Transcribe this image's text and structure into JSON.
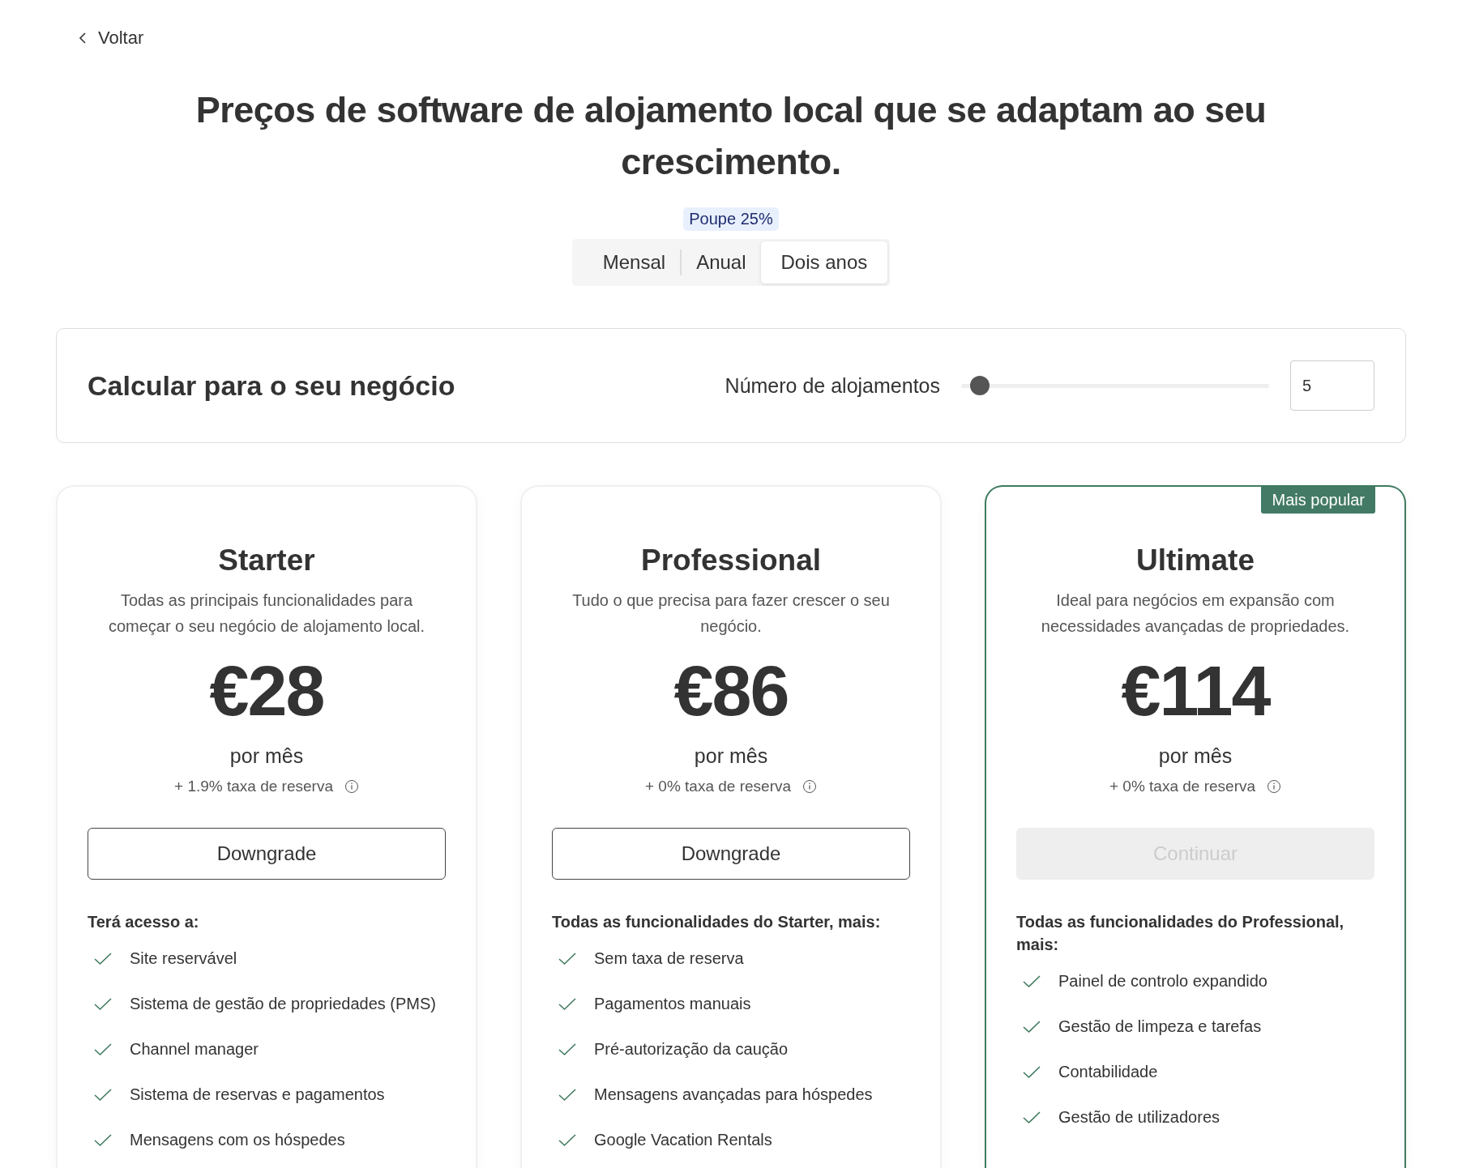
{
  "back_link": {
    "label": "Voltar"
  },
  "title": "Preços de software de alojamento local que se adaptam ao seu crescimento.",
  "savings_badge": "Poupe 25%",
  "billing_tabs": [
    {
      "label": "Mensal",
      "selected": false
    },
    {
      "label": "Anual",
      "selected": false
    },
    {
      "label": "Dois anos",
      "selected": true
    }
  ],
  "calculator": {
    "title": "Calcular para o seu negócio",
    "slider_label": "Número de alojamentos",
    "slider": {
      "level": 0.04
    },
    "value": "5"
  },
  "plans": [
    {
      "name": "Starter",
      "popular": false,
      "description": "Todas as principais funcionalidades para começar o seu negócio de alojamento local.",
      "price": "€28",
      "period": "por mês",
      "fee": "+ 1.9% taxa de reserva",
      "button": {
        "label": "Downgrade",
        "disabled": false
      },
      "features_title": "Terá acesso a:",
      "features": [
        "Site reservável",
        "Sistema de gestão de propriedades (PMS)",
        "Channel manager",
        "Sistema de reservas e pagamentos",
        "Mensagens com os hóspedes"
      ]
    },
    {
      "name": "Professional",
      "popular": false,
      "description": "Tudo o que precisa para fazer crescer o seu negócio.",
      "price": "€86",
      "period": "por mês",
      "fee": "+ 0% taxa de reserva",
      "button": {
        "label": "Downgrade",
        "disabled": false
      },
      "features_title": "Todas as funcionalidades do Starter, mais:",
      "features": [
        "Sem taxa de reserva",
        "Pagamentos manuais",
        "Pré-autorização da caução",
        "Mensagens avançadas para hóspedes",
        "Google Vacation Rentals"
      ]
    },
    {
      "name": "Ultimate",
      "popular": true,
      "badge": "Mais popular",
      "description": "Ideal para negócios em expansão com necessidades avançadas de propriedades.",
      "price": "€114",
      "period": "por mês",
      "fee": "+ 0% taxa de reserva",
      "button": {
        "label": "Continuar",
        "disabled": true
      },
      "features_title": "Todas as funcionalidades do Professional, mais:",
      "features": [
        "Painel de controlo expandido",
        "Gestão de limpeza e tarefas",
        "Contabilidade",
        "Gestão de utilizadores"
      ]
    }
  ]
}
